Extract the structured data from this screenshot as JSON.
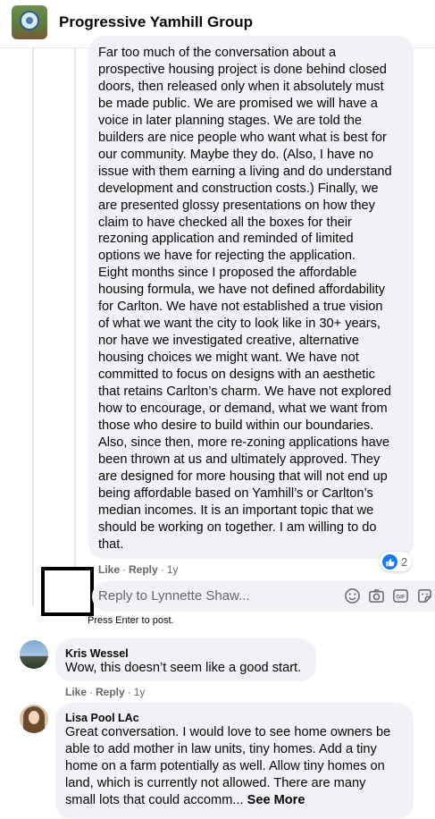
{
  "header": {
    "group_name": "Progressive Yamhill Group"
  },
  "main_comment": {
    "text": "Far too much of the conversation about a\nprospective housing project is done behind closed\ndoors, then released only when it absolutely must\nbe made public. We are promised we will have a\nvoice in later planning stages. We are told the\nbuilders are nice people who want what is best for\nour community. Maybe they do. (Also, I have no\nissue with them earning a living and do understand\ndevelopment and construction costs.) Finally, we\nare presented glossy presentations on how they\nclaim to have checked all the boxes for their\nrezoning application and reminded of limited\noptions we have for rejecting the application.\nEight months since I proposed the affordable\nhousing formula, we have not defined affordability\nfor Carlton. We have not established a true vision\nof what we want the city to look like in 30+ years,\nnor have we investigated creative, alternative\nhousing choices we might want. We have not\ncommitted to focus on designs with an aesthetic\nthat retains Carlton’s charm. We have not explored\nhow to encourage, or demand, what we want from\nthose who desire to build within our boundaries.\nAlso, since then, more re-zoning applications have\nbeen thrown at us and ultimately approved. They\nare designed for more housing that will not end up\nbeing affordable based on Yamhill’s or Carlton’s\nmedian incomes. It is an important topic that we\nshould be working on together. I am willing to do\nthat.",
    "like_label": "Like",
    "reply_label": "Reply",
    "time": "1y",
    "reaction_count": "2"
  },
  "reply_box": {
    "placeholder": "Reply to Lynnette Shaw...",
    "hint": "Press Enter to post."
  },
  "comments": [
    {
      "author": "Kris Wessel",
      "text": "Wow, this doesn’t seem like a good start.",
      "like_label": "Like",
      "reply_label": "Reply",
      "time": "1y"
    },
    {
      "author": "Lisa Pool LAc",
      "text": "Great conversation. I would love to see home owners be\nable to add mother in law units, tiny homes. Add a tiny\nhome on a farm potentially as well. Allow tiny homes on\nland, which is currently not allowed. There are many\nsmall lots that could accomm...",
      "see_more": "See More"
    }
  ],
  "colors": {
    "bubble": "#f0f2f5",
    "meta_text": "#65676b",
    "like_blue": "#1877f2"
  }
}
